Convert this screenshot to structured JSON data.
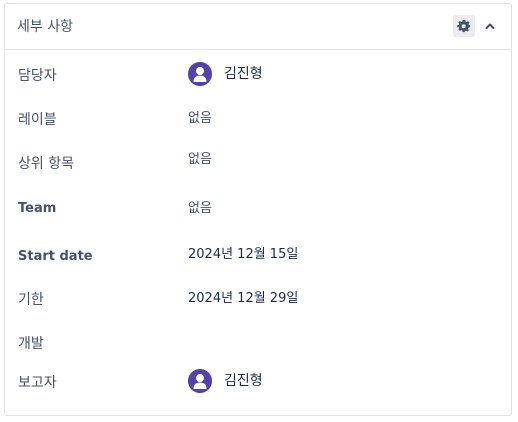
{
  "header": {
    "title": "세부 사항",
    "gear_icon": "gear-icon",
    "collapse_icon": "chevron-up-icon"
  },
  "fields": {
    "assignee": {
      "label": "담당자",
      "value": "김진형"
    },
    "labels": {
      "label": "레이블",
      "value": "없음"
    },
    "parent": {
      "label": "상위 항목",
      "value": "없음"
    },
    "team": {
      "label": "Team",
      "value": "없음"
    },
    "start_date": {
      "label": "Start date",
      "value": "2024년 12월 15일"
    },
    "due_date": {
      "label": "기한",
      "value": "2024년 12월 29일"
    },
    "development": {
      "label": "개발",
      "value": ""
    },
    "reporter": {
      "label": "보고자",
      "value": "김진형"
    }
  },
  "colors": {
    "avatar": "#5243aa",
    "label_text": "#42526e",
    "value_text": "#172b4d",
    "border": "#dfe1e6"
  }
}
